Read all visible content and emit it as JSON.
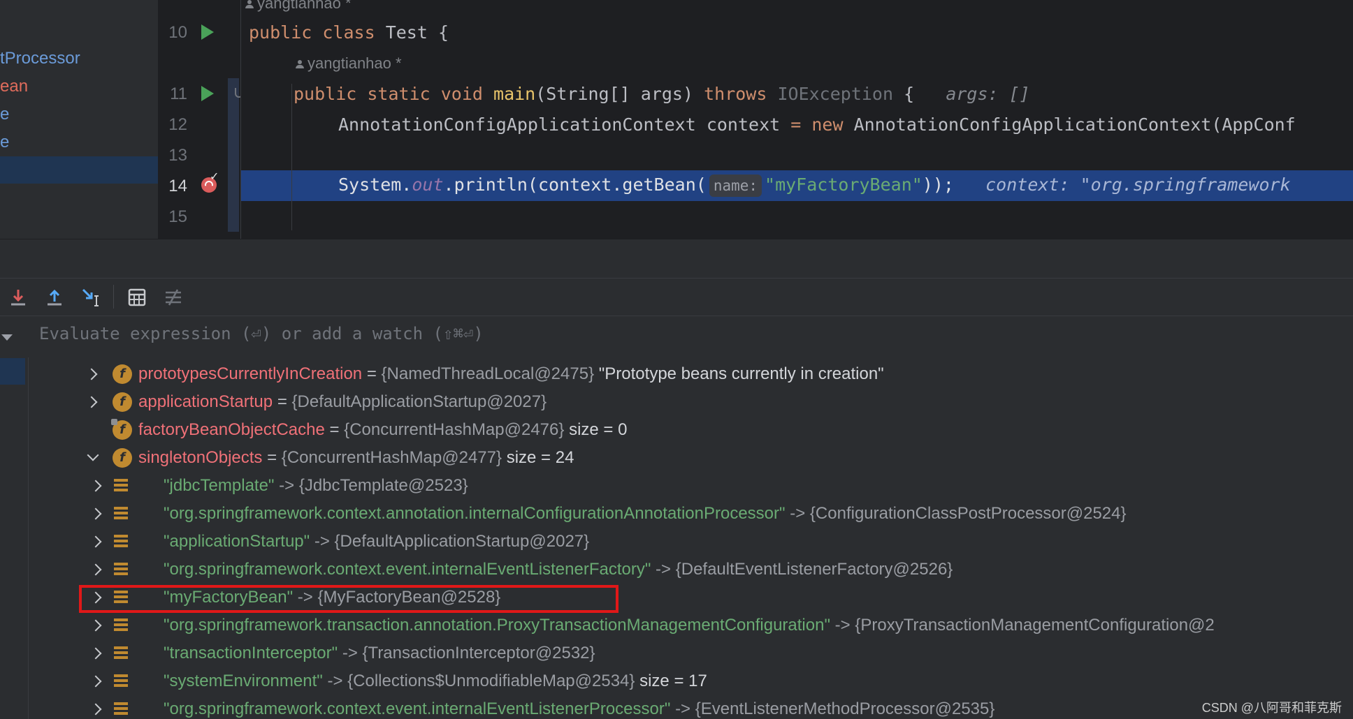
{
  "left_panel": {
    "items": [
      {
        "text": "tProcessor",
        "color": "blue"
      },
      {
        "text": "ean",
        "color": "red"
      },
      {
        "text": "e",
        "color": "blue"
      },
      {
        "text": "e",
        "color": "blue"
      }
    ]
  },
  "editor": {
    "top_author": "yangtianhao *",
    "method_author": "yangtianhao *",
    "line_numbers": [
      "10",
      "11",
      "12",
      "13",
      "14",
      "15"
    ],
    "line10": {
      "kw1": "public",
      "kw2": "class",
      "name": "Test",
      "brace": "{"
    },
    "line11": {
      "kw1": "public",
      "kw2": "static",
      "kw3": "void",
      "name": "main",
      "params": "(String[] args)",
      "throws": "throws",
      "exception": "IOException",
      "brace": "{",
      "hint": "args: []"
    },
    "line12": {
      "type": "AnnotationConfigApplicationContext",
      "var": "context",
      "eq": "=",
      "new": "new",
      "ctor": "AnnotationConfigApplicationContext(AppConf"
    },
    "line14": {
      "sys": "System.",
      "out": "out",
      "call": ".println(context.getBean(",
      "param_hint": "name:",
      "arg": "\"myFactoryBean\"",
      "close": "));",
      "hint": "context: \"org.springframework"
    }
  },
  "debugger": {
    "eval_placeholder": "Evaluate expression (⏎) or add a watch (⇧⌘⏎)",
    "fields": [
      {
        "name": "prototypesCurrentlyInCreation",
        "eq": "=",
        "type": "{NamedThreadLocal@2475}",
        "value": "\"Prototype beans currently in creation\"",
        "expand": "collapsed",
        "icon": "field-icon"
      },
      {
        "name": "applicationStartup",
        "eq": "=",
        "type": "{DefaultApplicationStartup@2027}",
        "value": "",
        "expand": "collapsed",
        "icon": "field-icon"
      },
      {
        "name": "factoryBeanObjectCache",
        "eq": "=",
        "type": "{ConcurrentHashMap@2476}",
        "value": "size = 0",
        "expand": "none",
        "icon": "field-icon"
      },
      {
        "name": "singletonObjects",
        "eq": "=",
        "type": "{ConcurrentHashMap@2477}",
        "value": "size = 24",
        "expand": "expanded",
        "icon": "field-icon"
      }
    ],
    "entries": [
      {
        "key": "\"jdbcTemplate\"",
        "arrow": "->",
        "type": "{JdbcTemplate@2523}",
        "value": ""
      },
      {
        "key": "\"org.springframework.context.annotation.internalConfigurationAnnotationProcessor\"",
        "arrow": "->",
        "type": "{ConfigurationClassPostProcessor@2524}",
        "value": ""
      },
      {
        "key": "\"applicationStartup\"",
        "arrow": "->",
        "type": "{DefaultApplicationStartup@2027}",
        "value": ""
      },
      {
        "key": "\"org.springframework.context.event.internalEventListenerFactory\"",
        "arrow": "->",
        "type": "{DefaultEventListenerFactory@2526}",
        "value": ""
      },
      {
        "key": "\"myFactoryBean\"",
        "arrow": "->",
        "type": "{MyFactoryBean@2528}",
        "value": ""
      },
      {
        "key": "\"org.springframework.transaction.annotation.ProxyTransactionManagementConfiguration\"",
        "arrow": "->",
        "type": "{ProxyTransactionManagementConfiguration@2",
        "value": ""
      },
      {
        "key": "\"transactionInterceptor\"",
        "arrow": "->",
        "type": "{TransactionInterceptor@2532}",
        "value": ""
      },
      {
        "key": "\"systemEnvironment\"",
        "arrow": "->",
        "type": "{Collections$UnmodifiableMap@2534}",
        "value": "size = 17"
      },
      {
        "key": "\"org.springframework.context.event.internalEventListenerProcessor\"",
        "arrow": "->",
        "type": "{EventListenerMethodProcessor@2535}",
        "value": ""
      }
    ],
    "toolbar_icons": [
      "step-into-icon",
      "step-out-icon",
      "run-to-cursor-icon",
      "evaluate-expression-icon",
      "trace-stream-icon"
    ]
  },
  "watermark": "CSDN @八阿哥和菲克斯",
  "colors": {
    "highlight_box": "#e01818",
    "current_line": "#214283",
    "field_name": "#f07178",
    "string_key": "#6aab73"
  }
}
